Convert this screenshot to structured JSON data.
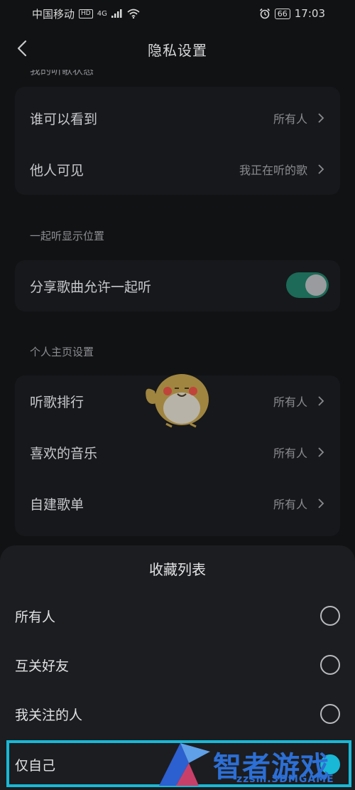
{
  "status_bar": {
    "carrier": "中国移动",
    "hd_badge": "HD",
    "network": "4G",
    "battery": "66",
    "time": "17:03"
  },
  "header": {
    "title": "隐私设置"
  },
  "sections": {
    "listening_status": {
      "label": "我的听歌状态",
      "rows": [
        {
          "label": "谁可以看到",
          "value": "所有人"
        },
        {
          "label": "他人可见",
          "value": "我正在听的歌"
        }
      ]
    },
    "listen_together": {
      "label": "一起听显示位置",
      "row_label": "分享歌曲允许一起听",
      "toggle_on": true,
      "toggle_color": "#1c6a57"
    },
    "profile": {
      "label": "个人主页设置",
      "rows": [
        {
          "label": "听歌排行",
          "value": "所有人"
        },
        {
          "label": "喜欢的音乐",
          "value": "所有人"
        },
        {
          "label": "自建歌单",
          "value": "所有人"
        }
      ]
    }
  },
  "sheet": {
    "title": "收藏列表",
    "options": [
      {
        "label": "所有人",
        "selected": false
      },
      {
        "label": "互关好友",
        "selected": false
      },
      {
        "label": "我关注的人",
        "selected": false
      },
      {
        "label": "仅自己",
        "selected": true
      }
    ],
    "highlight_color": "#19b8d6"
  },
  "watermark": {
    "text": "智者游戏网",
    "sub": "zzsm.3DMGAME"
  }
}
